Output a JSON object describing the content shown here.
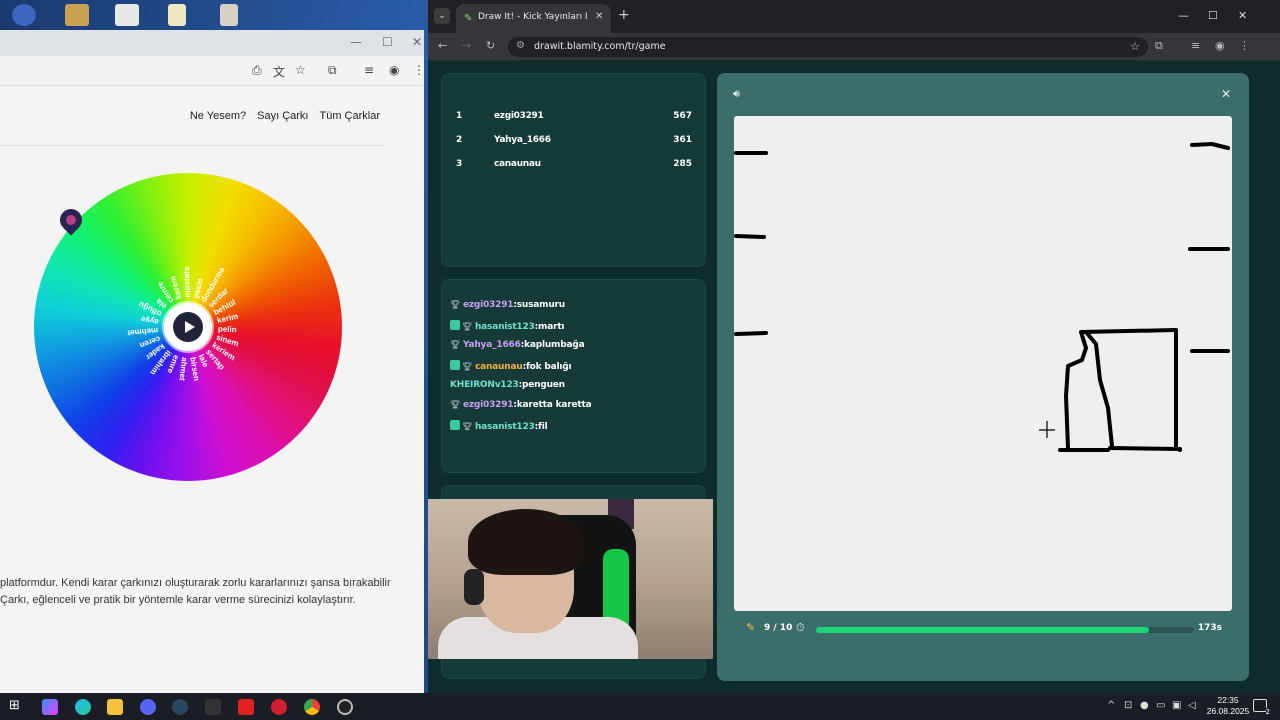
{
  "left_browser": {
    "nav": [
      "Ne Yesem?",
      "Sayı Çarkı",
      "Tüm Çarklar"
    ],
    "wheel_labels": [
      "dondurma",
      "serdar",
      "behlül",
      "kerim",
      "pelin",
      "sinem",
      "keriem",
      "sertap",
      "lale",
      "birsen",
      "ahmet",
      "emre",
      "ibrahim",
      "kader",
      "ceren",
      "mehmet",
      "ayşe",
      "ofluğu",
      "ela",
      "cemre",
      "kerem",
      "mustafa",
      "yasin"
    ],
    "desc_line1": "platformdur. Kendi karar çarkınızı oluşturarak zorlu kararlarınızı şansa bırakabilir",
    "desc_line2": "Çarkı, eğlenceli ve pratik bir yöntemle karar verme sürecinizi kolaylaştırır."
  },
  "right_browser": {
    "tab_title": "Draw It! - Kick Yayınları İçin Çizim",
    "url": "drawit.blamity.com/tr/game"
  },
  "leaderboard": [
    {
      "rank": "1",
      "name": "ezgi03291",
      "score": "567"
    },
    {
      "rank": "2",
      "name": "Yahya_1666",
      "score": "361"
    },
    {
      "rank": "3",
      "name": "canaunau",
      "score": "285"
    }
  ],
  "chat": [
    {
      "user": "ezgi03291",
      "msg": ":susamuru",
      "color": "#c9a0f0",
      "badge": false
    },
    {
      "user": "hasanist123",
      "msg": ":martı",
      "color": "#6ee0d0",
      "badge": true
    },
    {
      "user": "Yahya_1666",
      "msg": ":kaplumbağa",
      "color": "#c9a0f0",
      "badge": false
    },
    {
      "user": "canaunau",
      "msg": ":fok balığı",
      "color": "#f3b23a",
      "badge": true
    },
    {
      "user": "KHEIRONv123",
      "msg": ":penguen",
      "color": "#6ee0d0",
      "badge": false
    },
    {
      "user": "ezgi03291",
      "msg": ":karetta karetta",
      "color": "#c9a0f0",
      "badge": false
    },
    {
      "user": "hasanist123",
      "msg": ":fil",
      "color": "#6ee0d0",
      "badge": true
    }
  ],
  "game": {
    "round": "9 / 10",
    "progress": 0.88,
    "time_left": "173s"
  },
  "taskbar": {
    "time": "22:35",
    "date": "26.08.2025",
    "notifications": "2"
  },
  "colors": {
    "accent_green": "#1fd37a",
    "panel": "#153a38",
    "game_frame": "#3b6d6a"
  }
}
